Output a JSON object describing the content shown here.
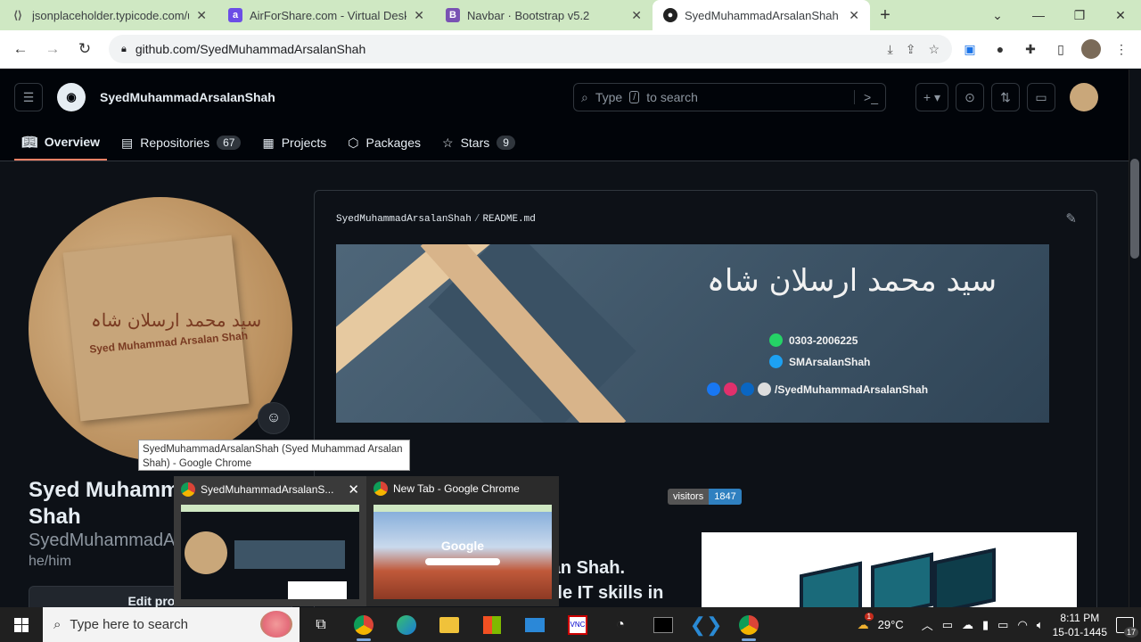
{
  "browser": {
    "tabs": [
      {
        "label": "jsonplaceholder.typicode.com/us",
        "icon": "code-icon"
      },
      {
        "label": "AirForShare.com - Virtual Deskto",
        "icon": "airforshare-icon"
      },
      {
        "label": "Navbar · Bootstrap v5.2",
        "icon": "bootstrap-icon"
      },
      {
        "label": "SyedMuhammadArsalanShah (Sy",
        "icon": "github-icon",
        "active": true
      }
    ],
    "url": "github.com/SyedMuhammadArsalanShah"
  },
  "header": {
    "username": "SyedMuhammadArsalanShah",
    "search_pre": "Type",
    "search_key": "/",
    "search_post": "to search"
  },
  "nav": {
    "items": [
      {
        "label": "Overview",
        "icon": "book-icon"
      },
      {
        "label": "Repositories",
        "count": "67",
        "icon": "repo-icon"
      },
      {
        "label": "Projects",
        "icon": "table-icon"
      },
      {
        "label": "Packages",
        "icon": "package-icon"
      },
      {
        "label": "Stars",
        "count": "9",
        "icon": "star-icon"
      }
    ]
  },
  "profile": {
    "image_urdu": "سید محمد ارسلان شاہ",
    "image_english": "Syed Muhammad Arsalan Shah",
    "name_line1": "Syed Muhamm",
    "name_line2": "Shah",
    "login": "SyedMuhammadArs",
    "pronouns": "he/him",
    "edit_label": "Edit profile"
  },
  "readme": {
    "owner": "SyedMuhammadArsalanShah",
    "separator": "/",
    "file": "README.md",
    "banner": {
      "urdu": "سید محمد ارسلان شاہ",
      "phone": "0303-2006225",
      "twitter": "SMArsalanShah",
      "github": "/SyedMuhammadArsalanShah"
    },
    "visitors_label": "visitors",
    "visitors_count": "1847",
    "intro_line1": "alan Shah.",
    "intro_line2": "tiple IT skills in"
  },
  "tooltip": "SyedMuhammadArsalanShah (Syed Muhammad Arsalan Shah) - Google Chrome",
  "preview": {
    "win1_title": "SyedMuhammadArsalanS...",
    "win2_title": "New Tab - Google Chrome",
    "google_text": "Google"
  },
  "taskbar": {
    "search_placeholder": "Type here to search",
    "weather": "29°C",
    "weather_badge": "1",
    "time": "8:11 PM",
    "date": "15-01-1445",
    "notifications": "17"
  },
  "colors": {
    "tab_bar": "#cfe8c3",
    "github_bg": "#0d1117",
    "underline": "#f78166",
    "visitors_badge": "#2f80c0"
  }
}
